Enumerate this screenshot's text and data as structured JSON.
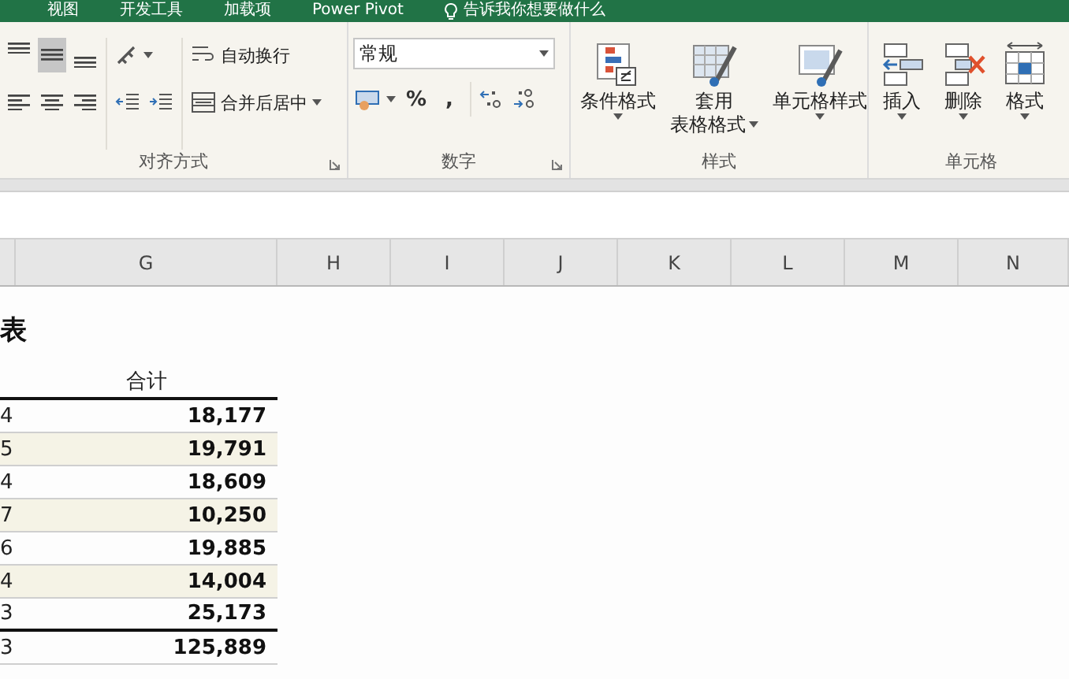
{
  "tabs": [
    {
      "label": "视图",
      "kind": "tab"
    },
    {
      "label": "开发工具",
      "kind": "tab"
    },
    {
      "label": "加载项",
      "kind": "tab"
    },
    {
      "label": "Power Pivot",
      "kind": "tab"
    },
    {
      "label": "告诉我你想要做什么",
      "kind": "tell_me"
    }
  ],
  "alignment": {
    "label": "对齐方式",
    "vertical_align": [
      {
        "kind": "top",
        "selected": false
      },
      {
        "kind": "middle",
        "selected": true
      },
      {
        "kind": "bottom",
        "selected": false
      }
    ],
    "horizontal_align": [
      {
        "kind": "left",
        "selected": false
      },
      {
        "kind": "center",
        "selected": false
      },
      {
        "kind": "right",
        "selected": false
      }
    ],
    "wrap_text": "自动换行",
    "merge_center": "合并后居中"
  },
  "number": {
    "label": "数字",
    "format": "常规",
    "percent": "%",
    "comma": ","
  },
  "styles": {
    "label": "样式",
    "buttons": [
      {
        "kind": "conditional",
        "lines": [
          "条件格式"
        ]
      },
      {
        "kind": "table",
        "lines": [
          "套用",
          "表格格式"
        ]
      },
      {
        "kind": "cell",
        "lines": [
          "单元格样式"
        ]
      }
    ]
  },
  "cells": {
    "label": "单元格",
    "buttons": [
      {
        "kind": "insert",
        "lines": [
          "插入"
        ]
      },
      {
        "kind": "delete",
        "lines": [
          "删除"
        ]
      },
      {
        "kind": "format",
        "lines": [
          "格式"
        ]
      }
    ]
  },
  "columns": [
    "G",
    "H",
    "I",
    "J",
    "K",
    "L",
    "M",
    "N"
  ],
  "sheet": {
    "title": "表",
    "header": "合计",
    "rows": [
      {
        "column_f": "4",
        "total": "18,177"
      },
      {
        "column_f": "5",
        "total": "19,791"
      },
      {
        "column_f": "4",
        "total": "18,609"
      },
      {
        "column_f": "7",
        "total": "10,250"
      },
      {
        "column_f": "6",
        "total": "19,885"
      },
      {
        "column_f": "4",
        "total": "14,004"
      },
      {
        "column_f": "3",
        "total": "25,173"
      }
    ],
    "total_row": {
      "column_f": "3",
      "total": "125,889"
    }
  }
}
